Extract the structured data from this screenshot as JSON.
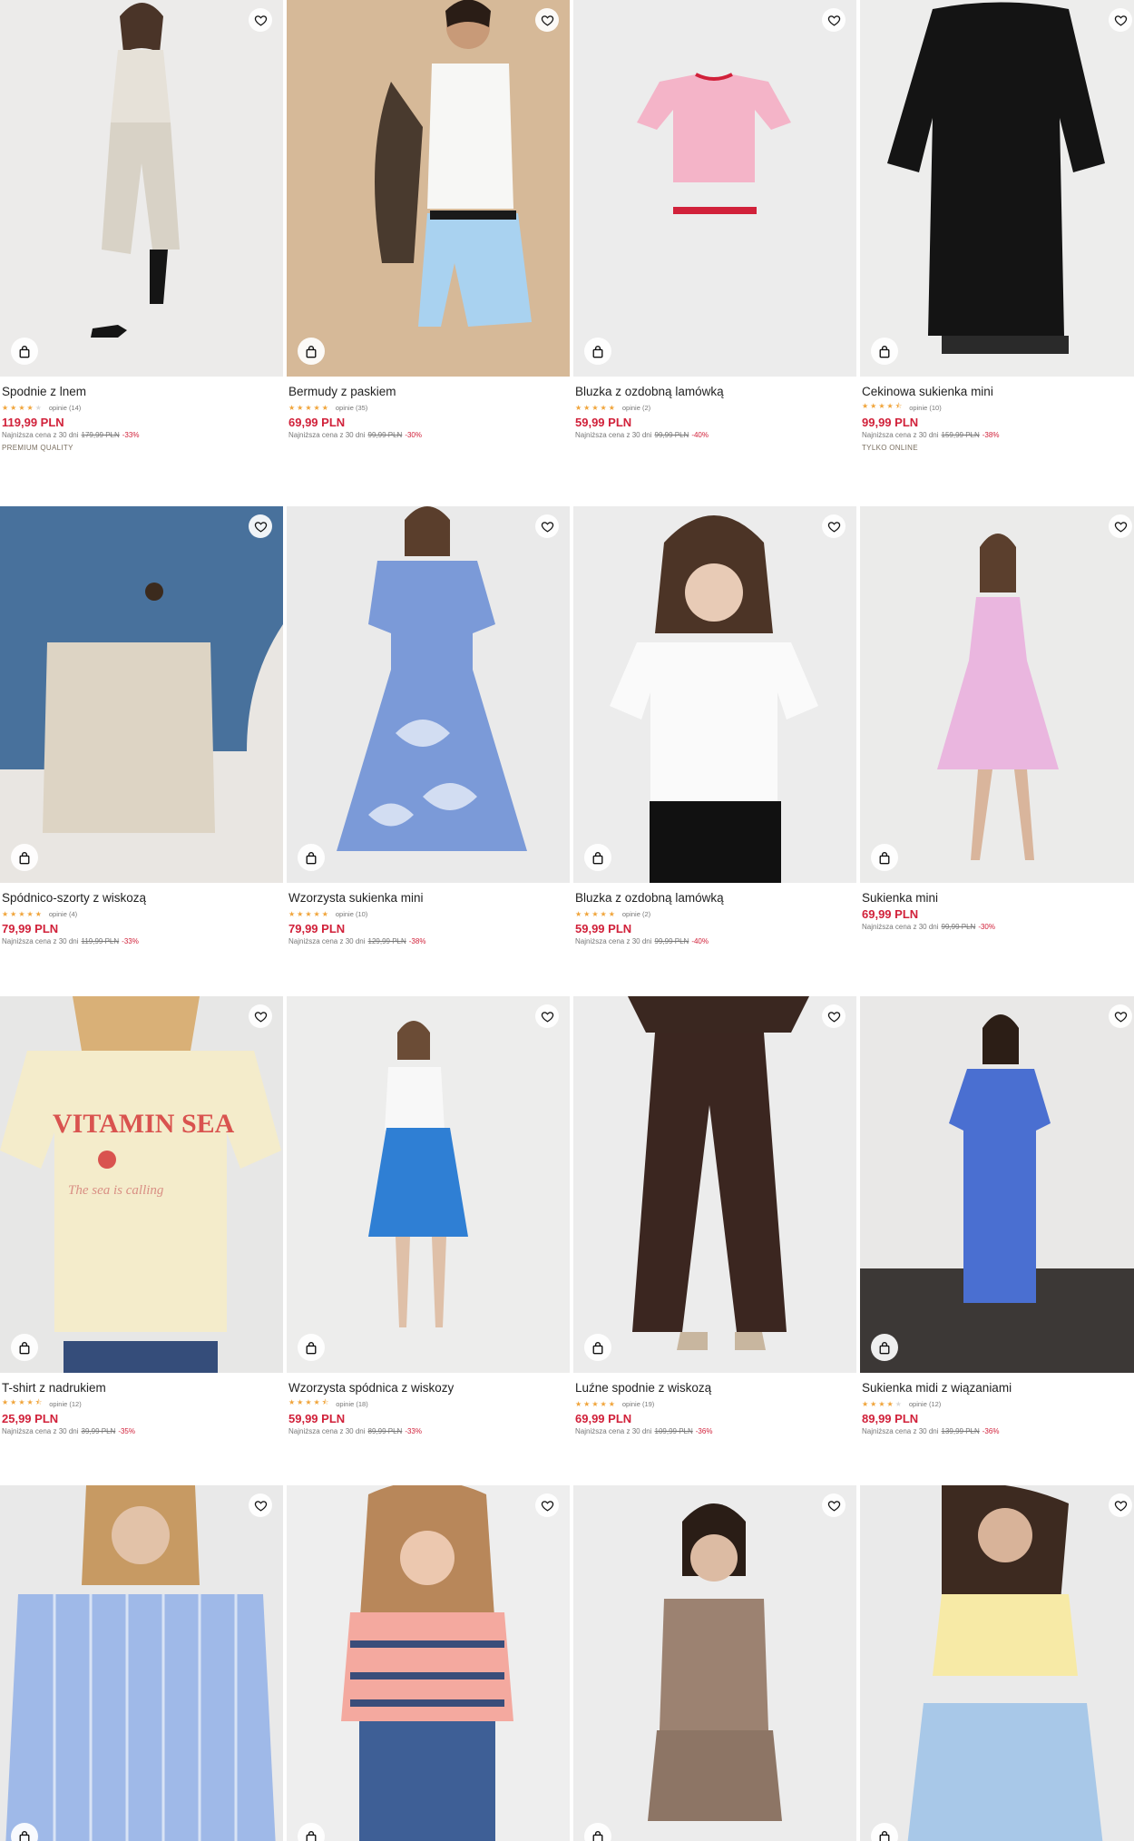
{
  "icons": {
    "wishlist": "heart-outline-icon",
    "add_to_cart": "shopping-bag-icon"
  },
  "colors": {
    "price": "#d1213a",
    "stars": "#f0a43a",
    "tag": "#7a6f60"
  },
  "products": [
    {
      "name": "Spodnie z lnem",
      "stars": 4,
      "reviews": "opinie (14)",
      "price": "119,99 PLN",
      "lowest_label": "Najniższa cena z 30 dni",
      "old_price": "179,99 PLN",
      "discount": "-33%",
      "tag": "PREMIUM QUALITY"
    },
    {
      "name": "Bermudy z paskiem",
      "stars": 5,
      "reviews": "opinie (35)",
      "price": "69,99 PLN",
      "lowest_label": "Najniższa cena z 30 dni",
      "old_price": "99,99 PLN",
      "discount": "-30%",
      "tag": ""
    },
    {
      "name": "Bluzka z ozdobną lamówką",
      "stars": 5,
      "reviews": "opinie (2)",
      "price": "59,99 PLN",
      "lowest_label": "Najniższa cena z 30 dni",
      "old_price": "99,99 PLN",
      "discount": "-40%",
      "tag": ""
    },
    {
      "name": "Cekinowa sukienka mini",
      "stars": 4.5,
      "reviews": "opinie (10)",
      "price": "99,99 PLN",
      "lowest_label": "Najniższa cena z 30 dni",
      "old_price": "159,99 PLN",
      "discount": "-38%",
      "tag": "TYLKO ONLINE"
    },
    {
      "name": "Spódnico-szorty z wiskozą",
      "stars": 5,
      "reviews": "opinie (4)",
      "price": "79,99 PLN",
      "lowest_label": "Najniższa cena z 30 dni",
      "old_price": "119,99 PLN",
      "discount": "-33%",
      "tag": ""
    },
    {
      "name": "Wzorzysta sukienka mini",
      "stars": 5,
      "reviews": "opinie (10)",
      "price": "79,99 PLN",
      "lowest_label": "Najniższa cena z 30 dni",
      "old_price": "129,99 PLN",
      "discount": "-38%",
      "tag": ""
    },
    {
      "name": "Bluzka z ozdobną lamówką",
      "stars": 5,
      "reviews": "opinie (2)",
      "price": "59,99 PLN",
      "lowest_label": "Najniższa cena z 30 dni",
      "old_price": "99,99 PLN",
      "discount": "-40%",
      "tag": ""
    },
    {
      "name": "Sukienka mini",
      "stars": 0,
      "reviews": "",
      "price": "69,99 PLN",
      "lowest_label": "Najniższa cena z 30 dni",
      "old_price": "99,99 PLN",
      "discount": "-30%",
      "tag": ""
    },
    {
      "name": "T-shirt z nadrukiem",
      "stars": 4.5,
      "reviews": "opinie (12)",
      "price": "25,99 PLN",
      "lowest_label": "Najniższa cena z 30 dni",
      "old_price": "39,99 PLN",
      "discount": "-35%",
      "tag": "",
      "print_text": "VITAMIN SEA",
      "print_sub": "The sea is calling"
    },
    {
      "name": "Wzorzysta spódnica z wiskozy",
      "stars": 4.5,
      "reviews": "opinie (18)",
      "price": "59,99 PLN",
      "lowest_label": "Najniższa cena z 30 dni",
      "old_price": "89,99 PLN",
      "discount": "-33%",
      "tag": ""
    },
    {
      "name": "Luźne spodnie z wiskozą",
      "stars": 5,
      "reviews": "opinie (19)",
      "price": "69,99 PLN",
      "lowest_label": "Najniższa cena z 30 dni",
      "old_price": "109,99 PLN",
      "discount": "-36%",
      "tag": ""
    },
    {
      "name": "Sukienka midi z wiązaniami",
      "stars": 4,
      "reviews": "opinie (12)",
      "price": "89,99 PLN",
      "lowest_label": "Najniższa cena z 30 dni",
      "old_price": "139,99 PLN",
      "discount": "-36%",
      "tag": ""
    },
    {
      "name": "",
      "stars": 0,
      "reviews": "",
      "price": "",
      "lowest_label": "",
      "old_price": "",
      "discount": "",
      "tag": ""
    },
    {
      "name": "",
      "stars": 0,
      "reviews": "",
      "price": "",
      "lowest_label": "",
      "old_price": "",
      "discount": "",
      "tag": ""
    },
    {
      "name": "",
      "stars": 0,
      "reviews": "",
      "price": "",
      "lowest_label": "",
      "old_price": "",
      "discount": "",
      "tag": ""
    },
    {
      "name": "",
      "stars": 0,
      "reviews": "",
      "price": "",
      "lowest_label": "",
      "old_price": "",
      "discount": "",
      "tag": ""
    }
  ]
}
